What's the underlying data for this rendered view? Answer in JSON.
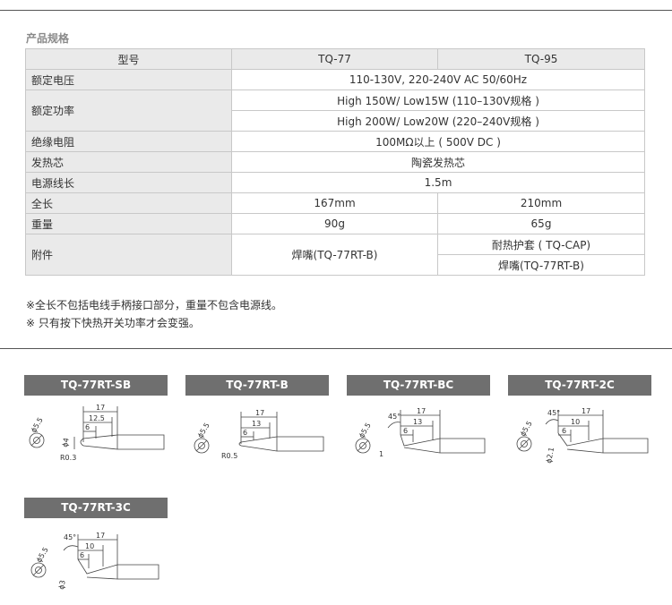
{
  "section_title": "产品规格",
  "table": {
    "header": {
      "label": "型号",
      "model_a": "TQ-77",
      "model_b": "TQ-95"
    },
    "rated_voltage": {
      "label": "额定电压",
      "value": "110-130V, 220-240V AC 50/60Hz"
    },
    "rated_power": {
      "label": "额定功率",
      "value_1": "High 150W/ Low15W (110–130V规格 )",
      "value_2": "High 200W/ Low20W (220–240V规格 )"
    },
    "insulation": {
      "label": "绝缘电阻",
      "value": "100MΩ以上 ( 500V DC )"
    },
    "heater": {
      "label": "发热芯",
      "value": "陶瓷发热芯"
    },
    "cord_length": {
      "label": "电源线长",
      "value": "1.5m"
    },
    "total_length": {
      "label": "全长",
      "a": "167mm",
      "b": "210mm"
    },
    "weight": {
      "label": "重量",
      "a": "90g",
      "b": "65g"
    },
    "accessories": {
      "label": "附件",
      "a": "焊嘴(TQ-77RT-B)",
      "b1": "耐热护套 ( TQ-CAP)",
      "b2": "焊嘴(TQ-77RT-B)"
    }
  },
  "notes": [
    "※全长不包括电线手柄接口部分，重量不包含电源线。",
    "※ 只有按下快热开关功率才会变强。"
  ],
  "tips": [
    {
      "name": "TQ-77RT-SB",
      "dims": [
        "17",
        "12.5",
        "6",
        "ϕ5.5",
        "ϕ4",
        "R0.3"
      ]
    },
    {
      "name": "TQ-77RT-B",
      "dims": [
        "17",
        "13",
        "6",
        "ϕ5.5",
        "R0.5"
      ]
    },
    {
      "name": "TQ-77RT-BC",
      "dims": [
        "17",
        "13",
        "6",
        "45°",
        "ϕ5.5",
        "1"
      ]
    },
    {
      "name": "TQ-77RT-2C",
      "dims": [
        "17",
        "10",
        "6",
        "45°",
        "ϕ5.5",
        "ϕ2.1"
      ]
    },
    {
      "name": "TQ-77RT-3C",
      "dims": [
        "17",
        "10",
        "6",
        "45°",
        "ϕ5.5",
        "ϕ3"
      ]
    }
  ]
}
